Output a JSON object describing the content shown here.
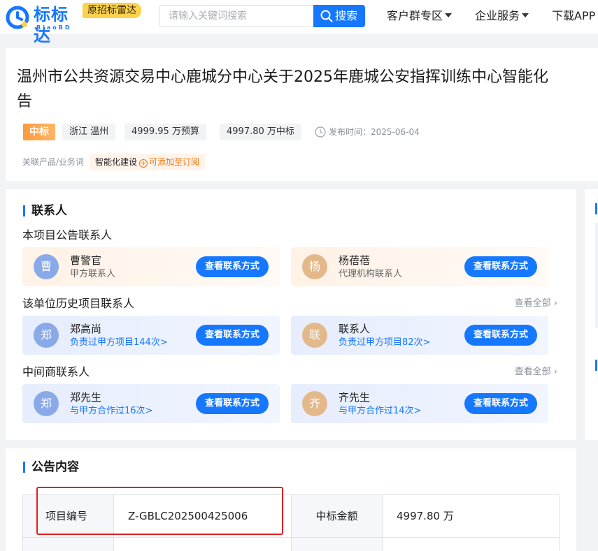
{
  "header": {
    "logo_name": "标标达",
    "logo_sub": "BiaoBD",
    "old_name": "原招标雷达",
    "search_placeholder": "请输入关键词搜索",
    "search_button": "搜索",
    "nav": [
      "客户群专区",
      "企业服务",
      "下载APP"
    ]
  },
  "notice": {
    "title_line1": "温州市公共资源交易中心鹿城分中心关于2025年鹿城公安指挥训练中心智能化",
    "title_line2": "告",
    "status": "中标",
    "region": "浙江 温州",
    "budget": "4999.95 万预算",
    "award": "4997.80 万中标",
    "publish_time": "发布时间：2025-06-04",
    "keyword_label": "关联产品/业务词",
    "keyword": "智能化建设",
    "keyword_add": "可添加至订阅"
  },
  "contacts": {
    "heading": "联系人",
    "groups": [
      {
        "title": "本项目公告联系人",
        "see_all": "",
        "cards": [
          {
            "avatar": "曹",
            "name": "曹警官",
            "role": "甲方联系人",
            "button": "查看联系方式"
          },
          {
            "avatar": "杨",
            "name": "杨蓓蓓",
            "role": "代理机构联系人",
            "button": "查看联系方式"
          }
        ]
      },
      {
        "title": "该单位历史项目联系人",
        "see_all": "查看全部",
        "cards": [
          {
            "avatar": "郑",
            "name": "郑高尚",
            "role": "负责过甲方项目144次>",
            "button": "查看联系方式"
          },
          {
            "avatar": "联",
            "name": "联系人",
            "role": "负责过甲方项目82次>",
            "button": "查看联系方式"
          }
        ]
      },
      {
        "title": "中间商联系人",
        "see_all": "查看全部",
        "cards": [
          {
            "avatar": "郑",
            "name": "郑先生",
            "role": "与甲方合作过16次>",
            "button": "查看联系方式"
          },
          {
            "avatar": "齐",
            "name": "齐先生",
            "role": "与甲方合作过14次>",
            "button": "查看联系方式"
          }
        ]
      }
    ]
  },
  "content": {
    "heading": "公告内容",
    "table": [
      {
        "label": "项目编号",
        "value": "Z-GBLC202500425006",
        "label2": "中标金额",
        "value2": "4997.80 万"
      }
    ]
  },
  "colors": {
    "brand": "#1677ff",
    "win_tag": "#ff9a3d",
    "highlight_box": "#e02020"
  }
}
